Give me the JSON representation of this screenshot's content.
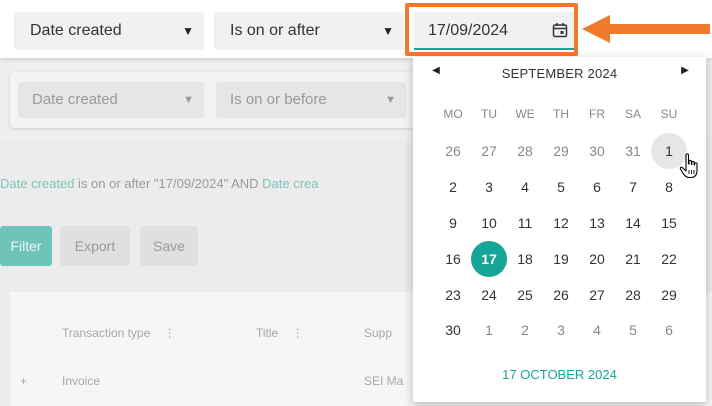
{
  "background": {
    "filter2": {
      "field": "Date created",
      "operator": "Is on or before"
    },
    "description": {
      "part1": "Date created",
      "part2": " is on or after \"17/09/2024\" AND ",
      "part3": "Date crea"
    },
    "buttons": {
      "filter": "Filter",
      "export": "Export",
      "save": "Save"
    },
    "table": {
      "columns": [
        "Transaction type",
        "Title",
        "Supp"
      ],
      "row1": {
        "expand": "+",
        "type": "Invoice",
        "supplier": "SEI Ma"
      }
    }
  },
  "filter1": {
    "field": "Date created",
    "operator": "Is on or after",
    "date_value": "17/09/2024"
  },
  "calendar": {
    "prev": "◀",
    "next": "▶",
    "month_label": "SEPTEMBER 2024",
    "weekdays": [
      "MO",
      "TU",
      "WE",
      "TH",
      "FR",
      "SA",
      "SU"
    ],
    "weeks": [
      [
        "26",
        "27",
        "28",
        "29",
        "30",
        "31",
        "1"
      ],
      [
        "2",
        "3",
        "4",
        "5",
        "6",
        "7",
        "8"
      ],
      [
        "9",
        "10",
        "11",
        "12",
        "13",
        "14",
        "15"
      ],
      [
        "16",
        "17",
        "18",
        "19",
        "20",
        "21",
        "22"
      ],
      [
        "23",
        "24",
        "25",
        "26",
        "27",
        "28",
        "29"
      ],
      [
        "30",
        "1",
        "2",
        "3",
        "4",
        "5",
        "6"
      ]
    ],
    "other_month": [
      [
        true,
        true,
        true,
        true,
        true,
        true,
        false
      ],
      [
        false,
        false,
        false,
        false,
        false,
        false,
        false
      ],
      [
        false,
        false,
        false,
        false,
        false,
        false,
        false
      ],
      [
        false,
        false,
        false,
        false,
        false,
        false,
        false
      ],
      [
        false,
        false,
        false,
        false,
        false,
        false,
        false
      ],
      [
        false,
        true,
        true,
        true,
        true,
        true,
        true
      ]
    ],
    "selected_day": "17",
    "hovered_day": "1",
    "footer": "17 OCTOBER 2024"
  },
  "colors": {
    "accent": "#16a596",
    "highlight": "#f07a2b"
  }
}
